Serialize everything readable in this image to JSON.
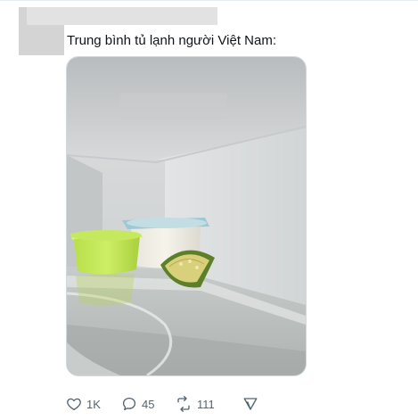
{
  "post": {
    "author_redacted": "",
    "text": "Trung bình tủ lạnh người Việt Nam:",
    "image_alt": "refrigerator interior with two yogurt cups and a lime slice"
  },
  "actions": {
    "likes": "1K",
    "replies": "45",
    "retweets": "111"
  },
  "icons": {
    "like": "heart-icon",
    "reply": "reply-icon",
    "retweet": "retweet-icon",
    "share": "share-icon"
  },
  "colors": {
    "text": "#0f1419",
    "action": "#536471",
    "border": "#cfd9de"
  }
}
